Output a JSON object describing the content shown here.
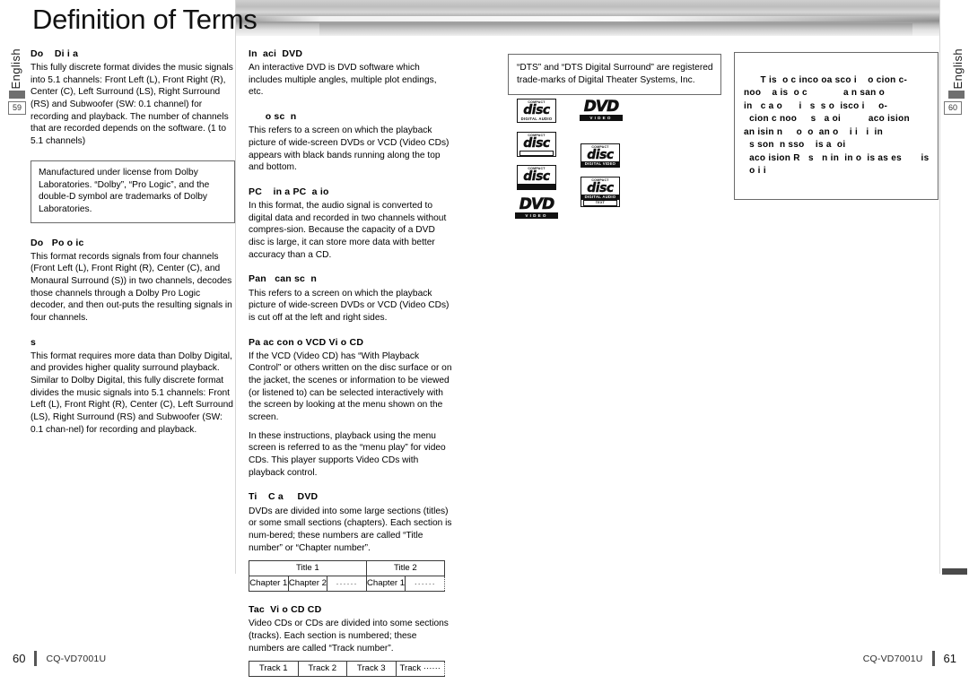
{
  "document": {
    "title": "Definition of Terms",
    "language_tab": "English",
    "left_page_chip": "59",
    "right_page_chip": "60",
    "model": "CQ-VD7001U",
    "left_page_number": "60",
    "right_page_number": "61"
  },
  "column1": {
    "entries": [
      {
        "term": "Do    Di i a",
        "body": "This fully discrete format divides the music signals into 5.1 channels: Front Left (L), Front Right (R), Center (C), Left Surround (LS), Right Surround (RS) and Subwoofer (SW: 0.1 channel) for recording and playback. The number of channels that are recorded depends on the software. (1 to 5.1 channels)"
      },
      {
        "term": "Do   Po o ic",
        "body": "This format records signals from four channels (Front Left (L), Front Right (R), Center (C), and Monaural Surround (S)) in two channels, decodes those channels through a Dolby Pro Logic decoder, and then out-puts the resulting signals in four channels."
      },
      {
        "term": "s",
        "body": "This format requires more data than Dolby Digital, and provides higher quality surround playback. Similar to Dolby Digital, this fully discrete format divides the music signals into 5.1 channels: Front Left (L), Front Right (R), Center (C), Left Surround (LS), Right Surround (RS) and Subwoofer (SW: 0.1 chan-nel) for recording and playback."
      }
    ],
    "dolby_note": "Manufactured under license from Dolby Laboratories. “Dolby”, “Pro Logic”, and the double-D symbol are trademarks of Dolby Laboratories."
  },
  "column2": {
    "entries": [
      {
        "term": "In  aci  DVD",
        "body": "An interactive DVD is DVD software which includes multiple angles, multiple plot endings, etc."
      },
      {
        "term": "      o sc  n",
        "body": "This refers to a screen on which the playback picture of wide-screen DVDs or VCD (Video CDs) appears with black bands running along the top and bottom."
      },
      {
        "term": "PC    in a PC  a io",
        "body": "In this format, the audio signal is converted to digital data and recorded in two channels without compres-sion. Because the capacity of a DVD disc is large, it can store more data with better accuracy than a CD."
      },
      {
        "term": "Pan   can sc  n",
        "body": "This refers to a screen on which the playback picture of wide-screen DVDs or VCD (Video CDs) is cut off at the left and right sides."
      },
      {
        "term": "Pa ac con o VCD Vi o CD",
        "body": "If the VCD (Video CD) has “With Playback Control” or others written on the disc surface or on the jacket, the scenes or information to be viewed (or listened to) can be selected interactively with the screen  by looking at the menu shown on the screen."
      },
      {
        "term": "",
        "body": "In these instructions, playback using the menu screen is referred to as the “menu play” for video CDs. This player supports Video CDs with playback control."
      },
      {
        "term": "Ti    C a     DVD",
        "body": "DVDs are divided into some large sections (titles) or some small sections (chapters). Each section is num-bered; these numbers are called “Title number” or “Chapter number”."
      },
      {
        "term": "Tac  Vi o CD CD",
        "body": "Video CDs or CDs are divided into some sections (tracks). Each section is numbered; these numbers are called “Track number”."
      }
    ],
    "title_table": {
      "row1": [
        "Title 1",
        "Title 2"
      ],
      "row2": [
        "Chapter 1",
        "Chapter 2",
        "······",
        "Chapter 1",
        "······"
      ]
    },
    "track_table": {
      "cells": [
        "Track 1",
        "Track 2",
        "Track 3",
        "Track ······"
      ]
    }
  },
  "column3": {
    "dts_note": "“DTS” and “DTS Digital Surround” are registered trade-marks of Digital Theater Systems, Inc.",
    "logos": [
      {
        "name": "compact-disc-digital-audio-logo",
        "cap": "COMPACT",
        "word": "disc",
        "sub": "DIGITAL AUDIO",
        "style": "plain"
      },
      {
        "name": "dvd-video-logo",
        "word": "DVD",
        "sub": "VIDEO",
        "style": "dvd"
      },
      {
        "name": "compact-disc-blank-logo",
        "cap": "COMPACT",
        "word": "disc",
        "sub": "",
        "style": "blank"
      },
      {
        "name": "compact-disc-digital-video-logo",
        "cap": "COMPACT",
        "word": "disc",
        "sub": "DIGITAL VIDEO",
        "style": "inverted"
      },
      {
        "name": "compact-disc-solid-logo",
        "cap": "COMPACT",
        "word": "disc",
        "sub": "",
        "style": "solid"
      },
      {
        "name": "compact-disc-digital-audio-text-logo",
        "cap": "COMPACT",
        "word": "disc",
        "sub": "DIGITAL AUDIO",
        "sub2": "TEXT",
        "style": "boxed"
      },
      {
        "name": "dvd-video-logo-2",
        "word": "DVD",
        "sub": "VIDEO",
        "style": "dvd"
      }
    ]
  },
  "column4": {
    "degraded_note": "  T is  o c inco oa sco i    o cion c-\nnoo    a is  o c             a n san o\nin   c a o      i   s  s o  isco i     o-\n  cion c noo     s   a oi          aco ision\nan isin n     o  o  an o    i i   i  in\n  s son  n sso    is a  oi\n  aco ision R   s   n in  in o  is as es       is\n  o i i"
  }
}
